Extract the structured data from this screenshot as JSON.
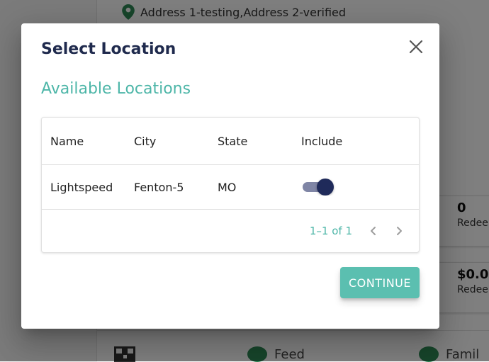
{
  "background": {
    "address": "Address 1-testing,Address 2-verified",
    "cards": [
      {
        "value": "0",
        "label": "Redee"
      },
      {
        "value": "$0.0",
        "label": "Redee"
      }
    ],
    "bottom_nav": [
      {
        "label": ""
      },
      {
        "label": "Feed"
      },
      {
        "label": "Famil"
      }
    ]
  },
  "dialog": {
    "title": "Select Location",
    "section_title": "Available Locations",
    "table": {
      "headers": [
        "Name",
        "City",
        "State",
        "Include"
      ],
      "rows": [
        {
          "name": "Lightspeed",
          "city": "Fenton-5",
          "state": "MO",
          "include": true
        }
      ]
    },
    "pagination": {
      "text": "1–1 of 1"
    },
    "continue_label": "CONTINUE"
  },
  "colors": {
    "accent": "#4db6a8",
    "title": "#1f2a4d",
    "toggle_thumb": "#1f2a5a",
    "button": "#5bbfb0"
  }
}
